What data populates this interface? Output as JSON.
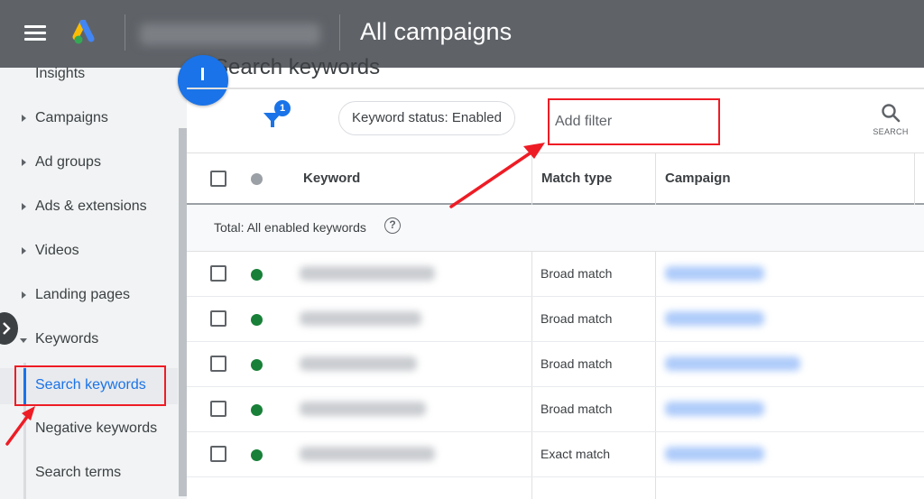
{
  "header": {
    "title": "All campaigns",
    "menu_icon": "hamburger-menu-icon",
    "logo_icon": "google-ads-logo-icon"
  },
  "sidebar": {
    "items": [
      {
        "label": "Insights",
        "expandable": false
      },
      {
        "label": "Campaigns",
        "expandable": true
      },
      {
        "label": "Ad groups",
        "expandable": true
      },
      {
        "label": "Ads & extensions",
        "expandable": true
      },
      {
        "label": "Videos",
        "expandable": true
      },
      {
        "label": "Landing pages",
        "expandable": true
      },
      {
        "label": "Keywords",
        "expandable": true,
        "expanded": true
      }
    ],
    "sub_items": [
      {
        "label": "Search keywords",
        "active": true
      },
      {
        "label": "Negative keywords",
        "active": false
      },
      {
        "label": "Search terms",
        "active": false
      }
    ]
  },
  "main": {
    "section_title": "Search keywords",
    "filter_count": "1",
    "status_chip": "Keyword status: Enabled",
    "filter_input_placeholder": "Add filter",
    "search_label": "SEARCH",
    "columns": {
      "keyword": "Keyword",
      "match_type": "Match type",
      "campaign": "Campaign"
    },
    "total_label": "Total: All enabled keywords",
    "rows": [
      {
        "status": "enabled",
        "match_type": "Broad match"
      },
      {
        "status": "enabled",
        "match_type": "Broad match"
      },
      {
        "status": "enabled",
        "match_type": "Broad match"
      },
      {
        "status": "enabled",
        "match_type": "Broad match"
      },
      {
        "status": "enabled",
        "match_type": "Exact match"
      }
    ]
  },
  "colors": {
    "topbar": "#5f6368",
    "accent": "#1a73e8",
    "enabled": "#188038",
    "annotation": "#ee1c25"
  }
}
